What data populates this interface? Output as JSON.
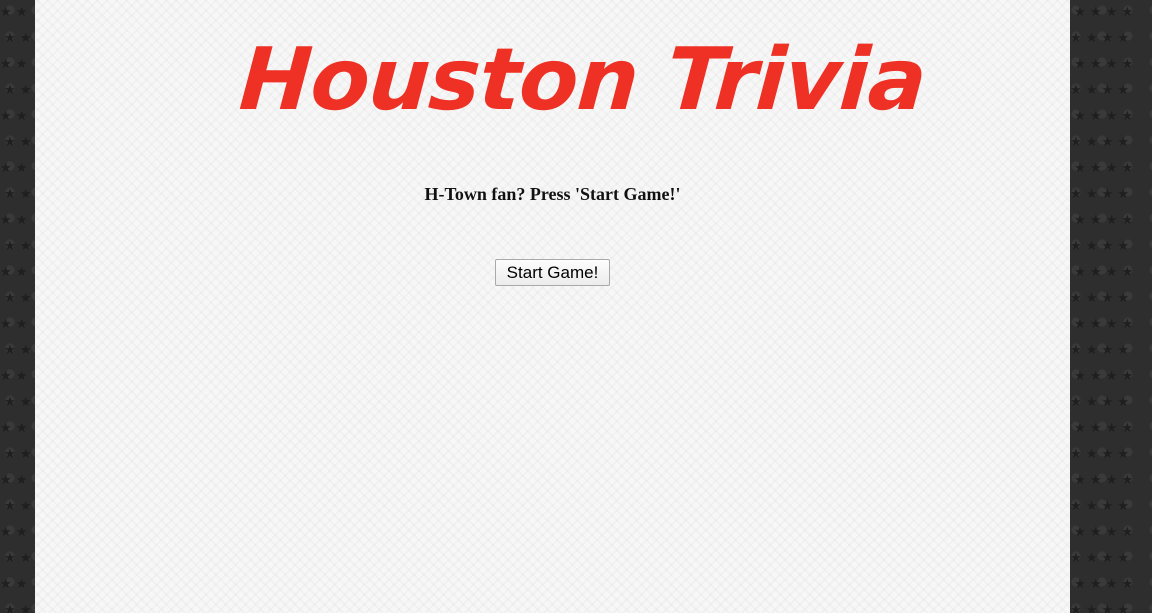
{
  "page": {
    "title": "Houston Trivia",
    "prompt": "H-Town fan? Press 'Start Game!'",
    "start_button_label": "Start Game!"
  },
  "colors": {
    "title": "#ee3124",
    "panel": "#f7f7f7",
    "background": "#2e2e2e"
  },
  "icons": {
    "background_pattern": "star-icon"
  }
}
